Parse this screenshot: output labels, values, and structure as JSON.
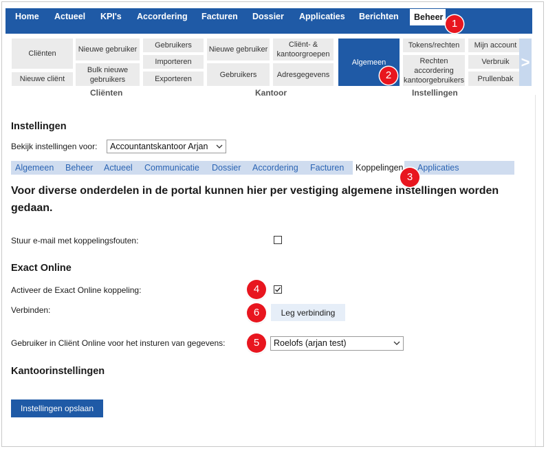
{
  "topnav": {
    "items": [
      {
        "label": "Home"
      },
      {
        "label": "Actueel"
      },
      {
        "label": "KPI's"
      },
      {
        "label": "Accordering"
      },
      {
        "label": "Facturen"
      },
      {
        "label": "Dossier"
      },
      {
        "label": "Applicaties"
      },
      {
        "label": "Berichten"
      },
      {
        "label": "Beheer",
        "active": true
      }
    ]
  },
  "markers": [
    "1",
    "2",
    "3",
    "4",
    "5",
    "6"
  ],
  "ribbon": {
    "clienten": {
      "label": "Cliënten",
      "buttons": [
        "Cliënten",
        "Nieuwe cliënt",
        "Nieuwe gebruiker",
        "Bulk nieuwe gebruikers",
        "Gebruikers",
        "Importeren",
        "Exporteren"
      ]
    },
    "kantoor": {
      "label": "Kantoor",
      "buttons": [
        "Nieuwe gebruiker",
        "Gebruikers",
        "Cliënt- & kantoorgroepen",
        "Adresgegevens"
      ]
    },
    "instellingen": {
      "label": "Instellingen",
      "buttons": [
        "Algemeen",
        "Tokens/rechten",
        "Rechten accordering kantoorgebruikers",
        "Mijn account",
        "Verbruik",
        "Prullenbak"
      ]
    },
    "scroll_glyph": ">"
  },
  "page": {
    "title": "Instellingen",
    "view_for_label": "Bekijk instellingen voor:",
    "view_for_value": "Accountantskantoor Arjan",
    "subtabs": [
      "Algemeen",
      "Beheer",
      "Actueel",
      "Communicatie",
      "Dossier",
      "Accordering",
      "Facturen",
      "Koppelingen",
      "Applicaties"
    ],
    "active_subtab": "Koppelingen",
    "intro": "Voor diverse onderdelen in de portal kunnen hier per vestiging algemene instellingen worden gedaan.",
    "email_errors_label": "Stuur e-mail met koppelingsfouten:",
    "email_errors_checked": false,
    "exact_section": "Exact Online",
    "activate_label": "Activeer de Exact Online koppeling:",
    "activate_checked": true,
    "connect_label": "Verbinden:",
    "connect_button": "Leg verbinding",
    "user_label": "Gebruiker in Cliënt Online voor het insturen van gegevens:",
    "user_value": "Roelofs (arjan test)",
    "office_section": "Kantoorinstellingen",
    "save_button": "Instellingen opslaan"
  },
  "colors": {
    "brand_blue": "#1f5aa6",
    "subtab_bar": "#cfdcef",
    "marker_red": "#e8161f"
  }
}
